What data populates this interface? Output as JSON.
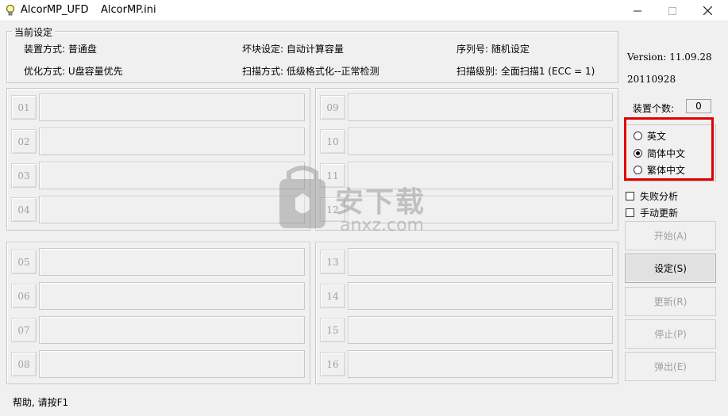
{
  "window": {
    "app_name": "AlcorMP_UFD",
    "file_name": "AlcorMP.ini"
  },
  "settings_group": {
    "title": "当前设定",
    "device_mode": "装置方式: 普通盘",
    "bad_block": "坏块设定: 自动计算容量",
    "serial": "序列号: 随机设定",
    "optimize": "优化方式: U盘容量优先",
    "scan_mode": "扫描方式: 低级格式化--正常检测",
    "scan_level": "扫描级别: 全面扫描1 (ECC = 1)"
  },
  "ports": {
    "p01": "01",
    "p02": "02",
    "p03": "03",
    "p04": "04",
    "p05": "05",
    "p06": "06",
    "p07": "07",
    "p08": "08",
    "p09": "09",
    "p10": "10",
    "p11": "11",
    "p12": "12",
    "p13": "13",
    "p14": "14",
    "p15": "15",
    "p16": "16"
  },
  "side": {
    "version": "Version: 11.09.28",
    "date": "20110928",
    "device_count_label": "装置个数:",
    "device_count": "0",
    "languages": [
      {
        "label": "英文",
        "selected": false
      },
      {
        "label": "简体中文",
        "selected": true
      },
      {
        "label": "繁体中文",
        "selected": false
      }
    ],
    "fail_analysis": "失败分析",
    "manual_update": "手动更新",
    "buttons": {
      "start": "开始(A)",
      "settings": "设定(S)",
      "update": "更新(R)",
      "stop": "停止(P)",
      "eject": "弹出(E)"
    }
  },
  "status_bar": "帮助, 请按F1",
  "watermark": {
    "line1": "安下载",
    "line2": "anxz.com"
  },
  "colors": {
    "highlight": "#e00000",
    "window_bg": "#f0f0f0",
    "disabled_text": "#a0a0a0"
  }
}
